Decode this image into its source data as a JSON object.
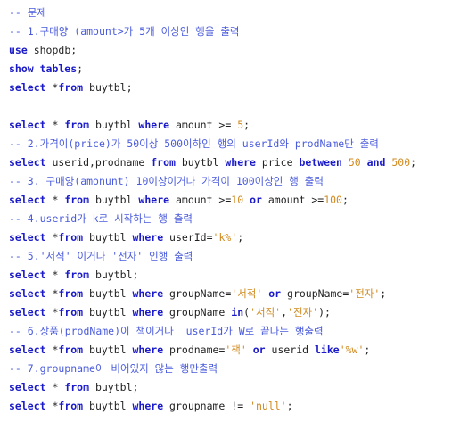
{
  "theme": {
    "keyword": "#1a1ac8",
    "comment": "#4a5bdc",
    "string": "#d08a1e",
    "number": "#d08a1e",
    "text": "#222222",
    "background": "#ffffff"
  },
  "code": {
    "lines": [
      [
        {
          "t": "comment",
          "v": "-- 문제"
        }
      ],
      [
        {
          "t": "comment",
          "v": "-- 1.구매양 (amount>가 5개 이상인 행을 출력"
        }
      ],
      [
        {
          "t": "kw",
          "v": "use"
        },
        {
          "t": "plain",
          "v": " shopdb;"
        }
      ],
      [
        {
          "t": "kw",
          "v": "show tables"
        },
        {
          "t": "plain",
          "v": ";"
        }
      ],
      [
        {
          "t": "kw",
          "v": "select"
        },
        {
          "t": "plain",
          "v": " *"
        },
        {
          "t": "kw",
          "v": "from"
        },
        {
          "t": "plain",
          "v": " buytbl;"
        }
      ],
      [],
      [
        {
          "t": "kw",
          "v": "select"
        },
        {
          "t": "plain",
          "v": " * "
        },
        {
          "t": "kw",
          "v": "from"
        },
        {
          "t": "plain",
          "v": " buytbl "
        },
        {
          "t": "kw",
          "v": "where"
        },
        {
          "t": "plain",
          "v": " amount >= "
        },
        {
          "t": "num",
          "v": "5"
        },
        {
          "t": "plain",
          "v": ";"
        }
      ],
      [
        {
          "t": "comment",
          "v": "-- 2.가격이(price)가 50이상 500이하인 행의 userId와 prodName만 출력"
        }
      ],
      [
        {
          "t": "kw",
          "v": "select"
        },
        {
          "t": "plain",
          "v": " userid,prodname "
        },
        {
          "t": "kw",
          "v": "from"
        },
        {
          "t": "plain",
          "v": " buytbl "
        },
        {
          "t": "kw",
          "v": "where"
        },
        {
          "t": "plain",
          "v": " price "
        },
        {
          "t": "kw",
          "v": "between"
        },
        {
          "t": "plain",
          "v": " "
        },
        {
          "t": "num",
          "v": "50"
        },
        {
          "t": "plain",
          "v": " "
        },
        {
          "t": "kw",
          "v": "and"
        },
        {
          "t": "plain",
          "v": " "
        },
        {
          "t": "num",
          "v": "500"
        },
        {
          "t": "plain",
          "v": ";"
        }
      ],
      [
        {
          "t": "comment",
          "v": "-- 3. 구매양(amonunt) 10이상이거나 가격이 100이상인 행 출력"
        }
      ],
      [
        {
          "t": "kw",
          "v": "select"
        },
        {
          "t": "plain",
          "v": " * "
        },
        {
          "t": "kw",
          "v": "from"
        },
        {
          "t": "plain",
          "v": " buytbl "
        },
        {
          "t": "kw",
          "v": "where"
        },
        {
          "t": "plain",
          "v": " amount >="
        },
        {
          "t": "num",
          "v": "10"
        },
        {
          "t": "plain",
          "v": " "
        },
        {
          "t": "kw",
          "v": "or"
        },
        {
          "t": "plain",
          "v": " amount >="
        },
        {
          "t": "num",
          "v": "100"
        },
        {
          "t": "plain",
          "v": ";"
        }
      ],
      [
        {
          "t": "comment",
          "v": "-- 4.userid가 k로 시작하는 행 출력"
        }
      ],
      [
        {
          "t": "kw",
          "v": "select"
        },
        {
          "t": "plain",
          "v": " *"
        },
        {
          "t": "kw",
          "v": "from"
        },
        {
          "t": "plain",
          "v": " buytbl "
        },
        {
          "t": "kw",
          "v": "where"
        },
        {
          "t": "plain",
          "v": " userId="
        },
        {
          "t": "str",
          "v": "'k%'"
        },
        {
          "t": "plain",
          "v": ";"
        }
      ],
      [
        {
          "t": "comment",
          "v": "-- 5.'서적' 이거나 '전자' 인행 출력"
        }
      ],
      [
        {
          "t": "kw",
          "v": "select"
        },
        {
          "t": "plain",
          "v": " * "
        },
        {
          "t": "kw",
          "v": "from"
        },
        {
          "t": "plain",
          "v": " buytbl;"
        }
      ],
      [
        {
          "t": "kw",
          "v": "select"
        },
        {
          "t": "plain",
          "v": " *"
        },
        {
          "t": "kw",
          "v": "from"
        },
        {
          "t": "plain",
          "v": " buytbl "
        },
        {
          "t": "kw",
          "v": "where"
        },
        {
          "t": "plain",
          "v": " groupName="
        },
        {
          "t": "str",
          "v": "'서적'"
        },
        {
          "t": "plain",
          "v": " "
        },
        {
          "t": "kw",
          "v": "or"
        },
        {
          "t": "plain",
          "v": " groupName="
        },
        {
          "t": "str",
          "v": "'전자'"
        },
        {
          "t": "plain",
          "v": ";"
        }
      ],
      [
        {
          "t": "kw",
          "v": "select"
        },
        {
          "t": "plain",
          "v": " *"
        },
        {
          "t": "kw",
          "v": "from"
        },
        {
          "t": "plain",
          "v": " buytbl "
        },
        {
          "t": "kw",
          "v": "where"
        },
        {
          "t": "plain",
          "v": " groupName "
        },
        {
          "t": "kw",
          "v": "in"
        },
        {
          "t": "plain",
          "v": "("
        },
        {
          "t": "str",
          "v": "'서적'"
        },
        {
          "t": "plain",
          "v": ","
        },
        {
          "t": "str",
          "v": "'전자'"
        },
        {
          "t": "plain",
          "v": ");"
        }
      ],
      [
        {
          "t": "comment",
          "v": "-- 6.상품(prodName)이 책이거나  userId가 W로 끝나는 행출력"
        }
      ],
      [
        {
          "t": "kw",
          "v": "select"
        },
        {
          "t": "plain",
          "v": " *"
        },
        {
          "t": "kw",
          "v": "from"
        },
        {
          "t": "plain",
          "v": " buytbl "
        },
        {
          "t": "kw",
          "v": "where"
        },
        {
          "t": "plain",
          "v": " prodname="
        },
        {
          "t": "str",
          "v": "'책'"
        },
        {
          "t": "plain",
          "v": " "
        },
        {
          "t": "kw",
          "v": "or"
        },
        {
          "t": "plain",
          "v": " userid "
        },
        {
          "t": "kw",
          "v": "like"
        },
        {
          "t": "str",
          "v": "'%w'"
        },
        {
          "t": "plain",
          "v": ";"
        }
      ],
      [
        {
          "t": "comment",
          "v": "-- 7.groupname이 비어있지 않는 행만출력"
        }
      ],
      [
        {
          "t": "kw",
          "v": "select"
        },
        {
          "t": "plain",
          "v": " * "
        },
        {
          "t": "kw",
          "v": "from"
        },
        {
          "t": "plain",
          "v": " buytbl;"
        }
      ],
      [
        {
          "t": "kw",
          "v": "select"
        },
        {
          "t": "plain",
          "v": " *"
        },
        {
          "t": "kw",
          "v": "from"
        },
        {
          "t": "plain",
          "v": " buytbl "
        },
        {
          "t": "kw",
          "v": "where"
        },
        {
          "t": "plain",
          "v": " groupname != "
        },
        {
          "t": "str",
          "v": "'null'"
        },
        {
          "t": "plain",
          "v": ";"
        }
      ]
    ]
  }
}
